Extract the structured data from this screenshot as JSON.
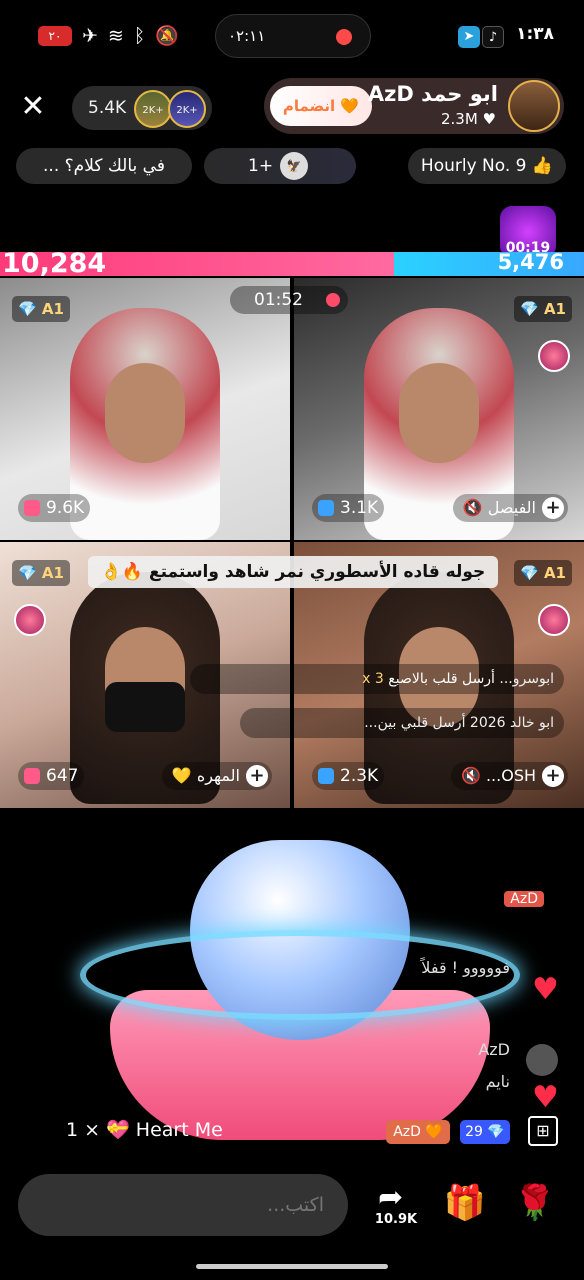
{
  "status_bar": {
    "time": "١:٣٨",
    "center_time": "٠٢:١١",
    "battery": "٢٠"
  },
  "header": {
    "viewer_count": "5.4K",
    "viewer_badges": [
      "2K+",
      "2K+"
    ],
    "host_name": "ابو حمد AzD",
    "host_likes": "2.3M ♥",
    "join_label": "انضمام"
  },
  "banners": {
    "topic": "في بالك كلام؟ ...",
    "rank_count": "1+",
    "hourly": "Hourly No. 9 👍"
  },
  "timer_gift": "00:19",
  "battle": {
    "left_score": "10,284",
    "right_score": "5,476",
    "timer": "01:52"
  },
  "tiles": [
    {
      "badge": "A1",
      "count": "9.6K",
      "name": ""
    },
    {
      "badge": "A1",
      "count": "3.1K",
      "name": "الفيصل"
    },
    {
      "badge": "A1",
      "count": "647",
      "name": "المهره"
    },
    {
      "badge": "A1",
      "count": "2.3K",
      "name": "OSH..."
    }
  ],
  "caption": "جوله قاده الأسطوري نمر شاهد واستمتع 🔥👌",
  "gift_notes": [
    {
      "user": "ابوسرو...",
      "text": "أرسل قلب بالاصبع",
      "count": "x 3"
    },
    {
      "user": "ابو خالد 2026",
      "text": "أرسل قلبي بين..."
    }
  ],
  "chat": [
    {
      "user": "AzD",
      "text": ""
    },
    {
      "user": "",
      "text": "فووووو ! قفلاً"
    },
    {
      "user": "AzD",
      "text": "نايم"
    }
  ],
  "gift_feed": {
    "text": "1 × 💝 Heart Me",
    "fan_badge": "AzD 🧡",
    "level": "29 💎"
  },
  "bottom_bar": {
    "input_placeholder": "اكتب...",
    "share_count": "10.9K"
  }
}
